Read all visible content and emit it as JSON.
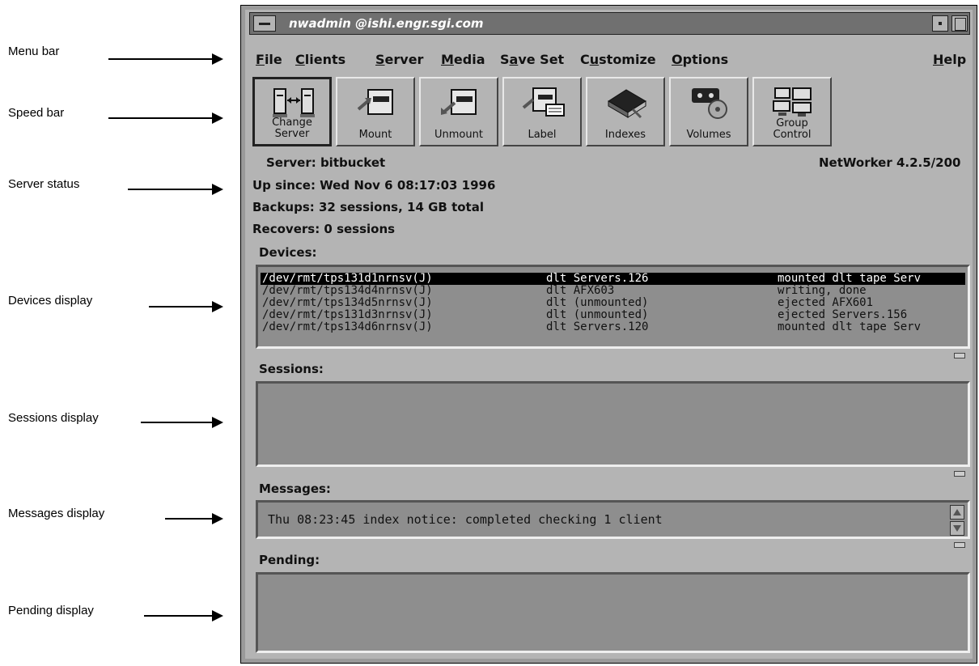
{
  "callouts": {
    "menu_bar": "Menu bar",
    "speed_bar": "Speed bar",
    "server_status": "Server status",
    "devices_display": "Devices display",
    "sessions_display": "Sessions display",
    "messages_display": "Messages display",
    "pending_display": "Pending display"
  },
  "window": {
    "title": "nwadmin @ishi.engr.sgi.com"
  },
  "menu": {
    "file": {
      "u": "F",
      "rest": "ile"
    },
    "clients": {
      "u": "C",
      "rest": "lients"
    },
    "server": {
      "u": "S",
      "rest": "erver"
    },
    "media": {
      "u": "M",
      "rest": "edia"
    },
    "saveset": {
      "pre": "S",
      "u": "a",
      "rest": "ve Set"
    },
    "customize": {
      "pre": "C",
      "u": "u",
      "rest": "stomize"
    },
    "options": {
      "u": "O",
      "rest": "ptions"
    },
    "help": {
      "u": "H",
      "rest": "elp"
    }
  },
  "speedbar": {
    "change_server_1": "Change",
    "change_server_2": "Server",
    "mount": "Mount",
    "unmount": "Unmount",
    "label": "Label",
    "indexes": "Indexes",
    "volumes": "Volumes",
    "group_control_1": "Group",
    "group_control_2": "Control"
  },
  "status": {
    "server": "Server: bitbucket",
    "up_since": "Up since: Wed Nov  6 08:17:03 1996",
    "backups": "Backups: 32 sessions, 14 GB total",
    "recovers": "Recovers: 0 sessions",
    "version": "NetWorker 4.2.5/200"
  },
  "sections": {
    "devices": "Devices:",
    "sessions": "Sessions:",
    "messages": "Messages:",
    "pending": "Pending:"
  },
  "devices": [
    {
      "path": "/dev/rmt/tps131d1nrnsv(J)",
      "media": "dlt Servers.126",
      "status": "mounted dlt tape Serv"
    },
    {
      "path": "/dev/rmt/tps134d4nrnsv(J)",
      "media": "dlt AFX603",
      "status": "writing, done"
    },
    {
      "path": "/dev/rmt/tps134d5nrnsv(J)",
      "media": "dlt (unmounted)",
      "status": "ejected AFX601"
    },
    {
      "path": "/dev/rmt/tps131d3nrnsv(J)",
      "media": "dlt (unmounted)",
      "status": "ejected Servers.156"
    },
    {
      "path": "/dev/rmt/tps134d6nrnsv(J)",
      "media": "dlt Servers.120",
      "status": "mounted dlt tape Serv"
    }
  ],
  "messages": {
    "line": "Thu 08:23:45 index notice: completed checking 1 client"
  }
}
